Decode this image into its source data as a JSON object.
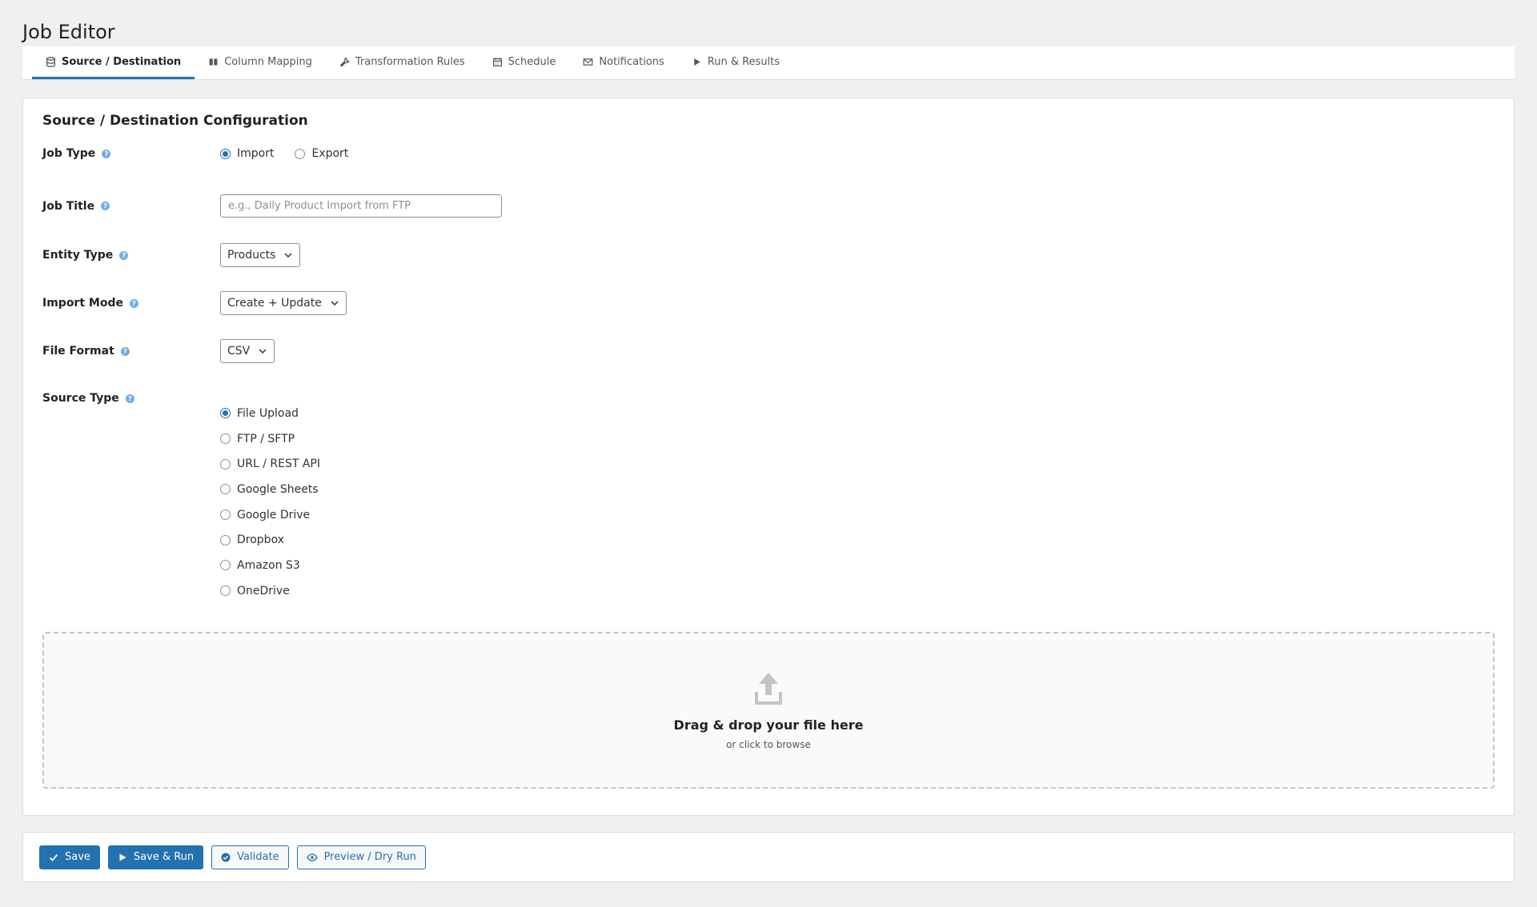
{
  "page": {
    "title": "Job Editor"
  },
  "tabs": [
    {
      "label": "Source / Destination",
      "icon": "database-icon",
      "active": true
    },
    {
      "label": "Column Mapping",
      "icon": "columns-icon",
      "active": false
    },
    {
      "label": "Transformation Rules",
      "icon": "wrench-icon",
      "active": false
    },
    {
      "label": "Schedule",
      "icon": "calendar-icon",
      "active": false
    },
    {
      "label": "Notifications",
      "icon": "mail-icon",
      "active": false
    },
    {
      "label": "Run & Results",
      "icon": "play-icon",
      "active": false
    }
  ],
  "form": {
    "title": "Source / Destination Configuration",
    "help_glyph": "?",
    "job_type": {
      "label": "Job Type",
      "options": [
        "Import",
        "Export"
      ],
      "selected": "Import"
    },
    "job_title": {
      "label": "Job Title",
      "value": "",
      "placeholder": "e.g., Daily Product Import from FTP"
    },
    "entity_type": {
      "label": "Entity Type",
      "value": "Products"
    },
    "import_mode": {
      "label": "Import Mode",
      "value": "Create + Update"
    },
    "file_format": {
      "label": "File Format",
      "value": "CSV"
    },
    "source_type": {
      "label": "Source Type",
      "options": [
        "File Upload",
        "FTP / SFTP",
        "URL / REST API",
        "Google Sheets",
        "Google Drive",
        "Dropbox",
        "Amazon S3",
        "OneDrive"
      ],
      "selected": "File Upload"
    }
  },
  "dropzone": {
    "main_text": "Drag & drop your file here",
    "sub_text": "or click to browse",
    "icon": "upload-icon"
  },
  "actions": {
    "save": "Save",
    "save_run": "Save & Run",
    "validate": "Validate",
    "preview": "Preview / Dry Run"
  },
  "colors": {
    "accent": "#2271b1",
    "help": "#72aee6",
    "background": "#f0f0f1"
  }
}
